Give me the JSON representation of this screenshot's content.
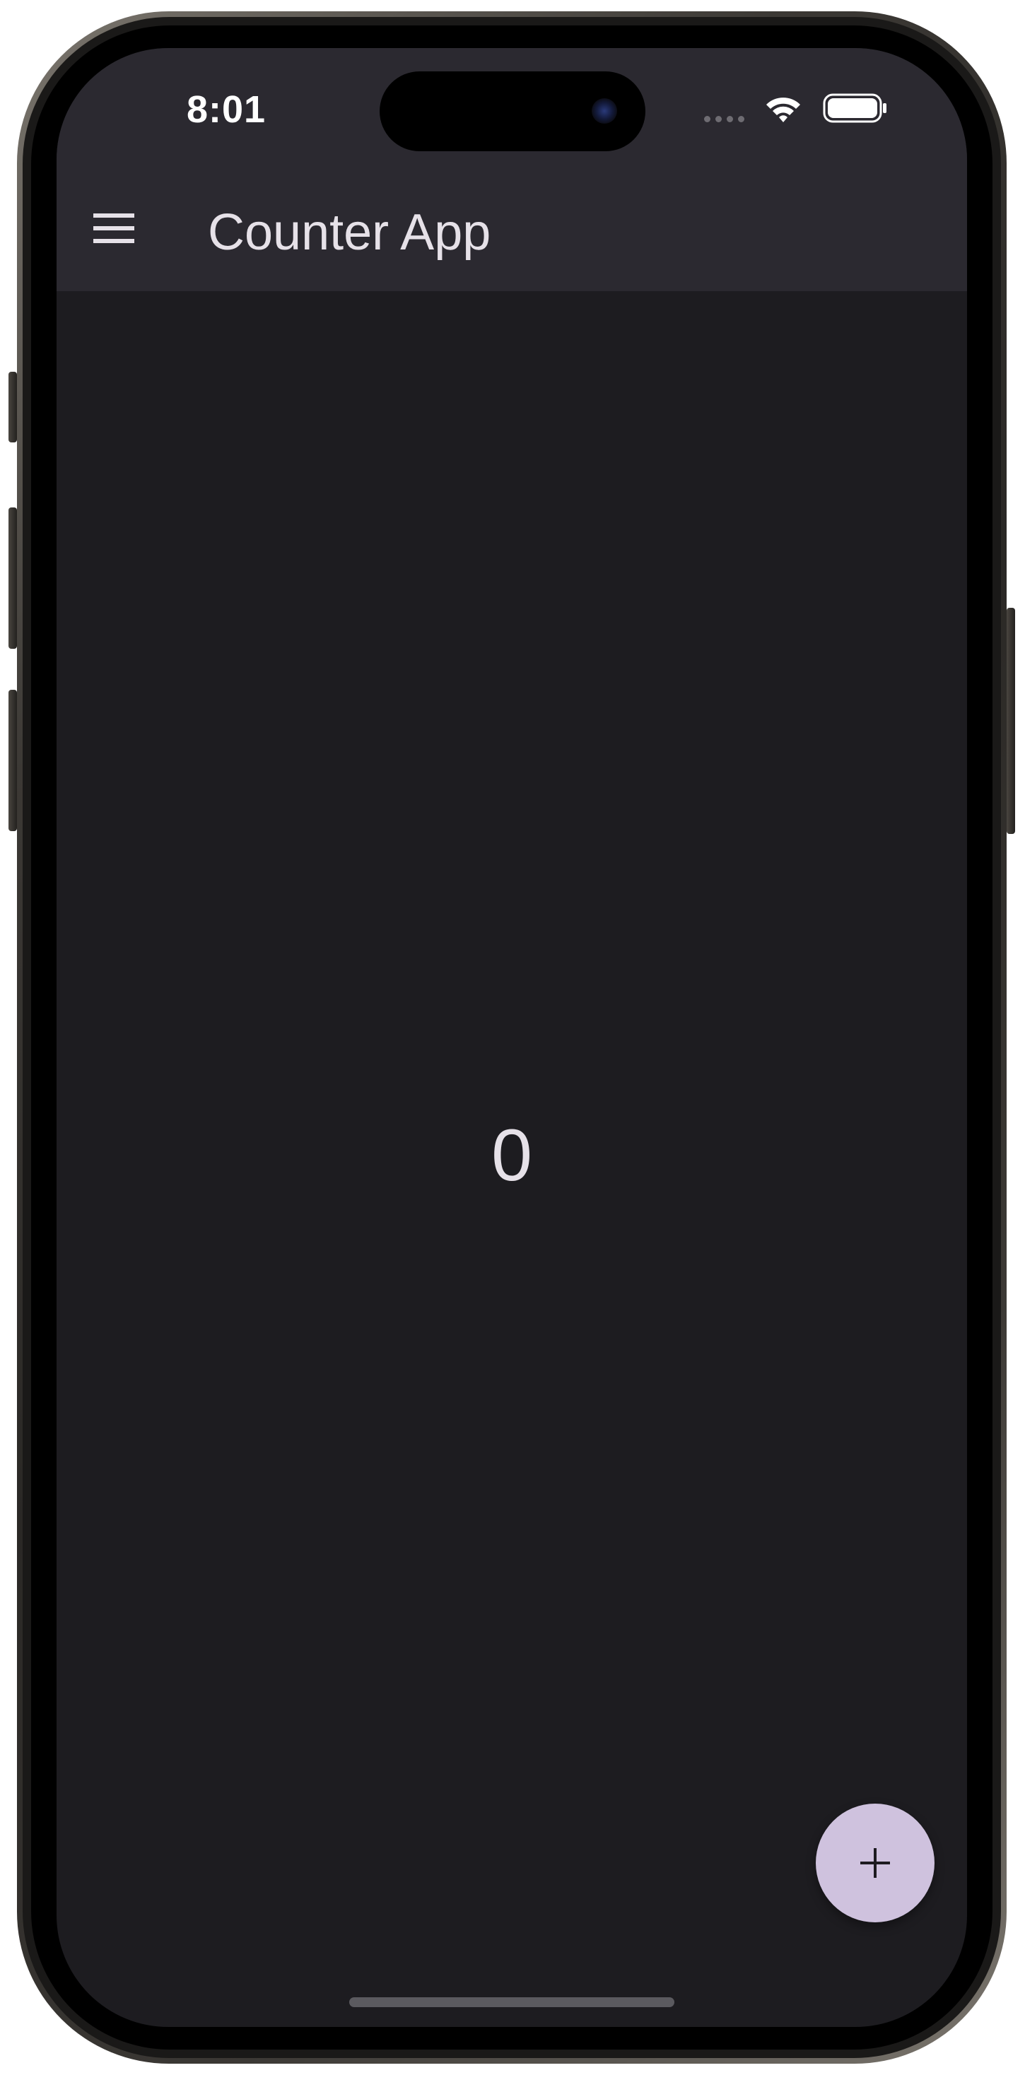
{
  "status_bar": {
    "time": "8:01"
  },
  "app_bar": {
    "title": "Counter App",
    "menu_icon": "hamburger-menu-icon"
  },
  "counter": {
    "value": "0"
  },
  "fab": {
    "icon": "plus-icon",
    "color": "#cfc2de"
  },
  "colors": {
    "app_bar_bg": "#2b2930",
    "screen_bg": "#1d1c20",
    "text": "#e6e1e8"
  }
}
